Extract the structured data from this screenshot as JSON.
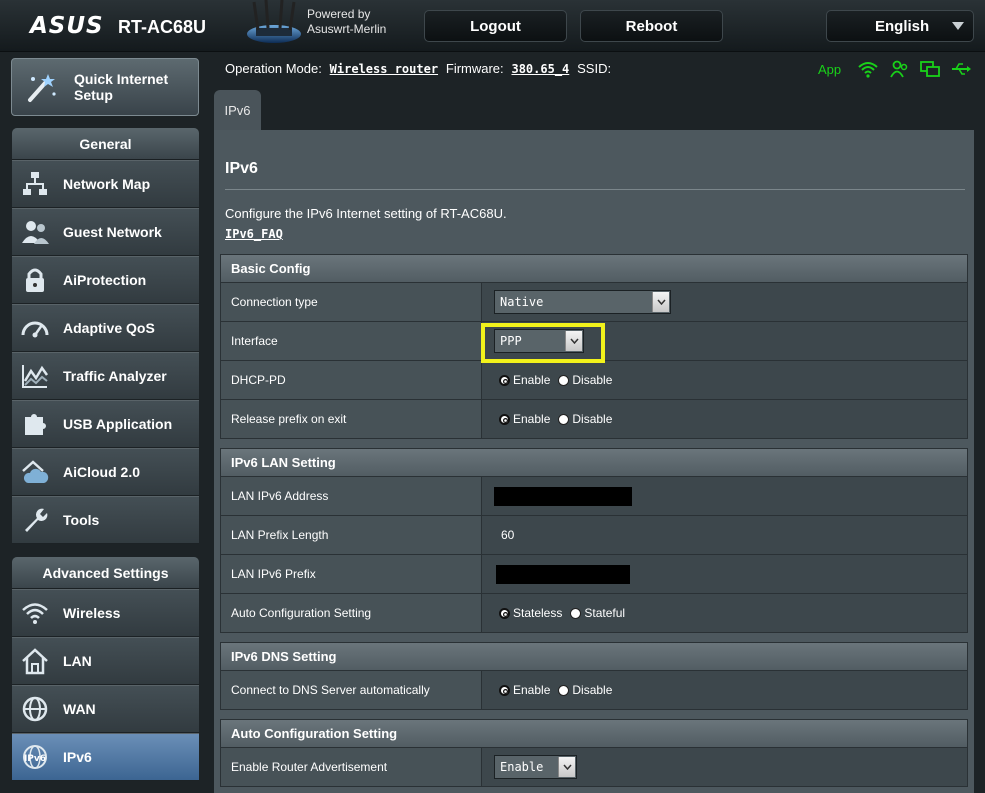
{
  "header": {
    "brand": "ASUS",
    "model": "RT-AC68U",
    "powered_by_line1": "Powered by",
    "powered_by_line2": "Asuswrt-Merlin",
    "logout_label": "Logout",
    "reboot_label": "Reboot",
    "language": "English"
  },
  "sidebar": {
    "quick_setup_label": "Quick Internet Setup",
    "general_header": "General",
    "general_items": [
      {
        "label": "Network Map",
        "icon": "network-map-icon"
      },
      {
        "label": "Guest Network",
        "icon": "guest-network-icon"
      },
      {
        "label": "AiProtection",
        "icon": "lock-icon"
      },
      {
        "label": "Adaptive QoS",
        "icon": "gauge-icon"
      },
      {
        "label": "Traffic Analyzer",
        "icon": "traffic-analyzer-icon"
      },
      {
        "label": "USB Application",
        "icon": "puzzle-icon"
      },
      {
        "label": "AiCloud 2.0",
        "icon": "cloud-home-icon"
      },
      {
        "label": "Tools",
        "icon": "wrench-icon"
      }
    ],
    "advanced_header": "Advanced Settings",
    "advanced_items": [
      {
        "label": "Wireless",
        "icon": "wifi-icon"
      },
      {
        "label": "LAN",
        "icon": "house-icon"
      },
      {
        "label": "WAN",
        "icon": "globe-icon"
      },
      {
        "label": "IPv6",
        "icon": "ipv6-globe-icon",
        "active": true
      }
    ]
  },
  "status": {
    "operation_mode_label": "Operation Mode:",
    "operation_mode_value": "Wireless router",
    "firmware_label": "Firmware:",
    "firmware_value": "380.65_4",
    "ssid_label": "SSID:",
    "app_label": "App",
    "accent_color": "#19d219"
  },
  "tabs": [
    {
      "label": "IPv6",
      "active": true
    }
  ],
  "page": {
    "title": "IPv6",
    "description": "Configure the IPv6 Internet setting of RT-AC68U.",
    "faq_link": "IPv6_FAQ"
  },
  "sections": {
    "basic": {
      "header": "Basic Config",
      "connection_type_label": "Connection type",
      "connection_type_value": "Native",
      "interface_label": "Interface",
      "interface_value": "PPP",
      "dhcp_pd_label": "DHCP-PD",
      "release_prefix_label": "Release prefix on exit",
      "enable": "Enable",
      "disable": "Disable"
    },
    "lan": {
      "header": "IPv6 LAN Setting",
      "address_label": "LAN IPv6 Address",
      "prefix_length_label": "LAN Prefix Length",
      "prefix_length_value": "60",
      "prefix_label": "LAN IPv6 Prefix",
      "autoconf_label": "Auto Configuration Setting",
      "stateless": "Stateless",
      "stateful": "Stateful"
    },
    "dns": {
      "header": "IPv6 DNS Setting",
      "auto_label": "Connect to DNS Server automatically",
      "enable": "Enable",
      "disable": "Disable"
    },
    "autoconf": {
      "header": "Auto Configuration Setting",
      "router_adv_label": "Enable Router Advertisement",
      "router_adv_value": "Enable"
    }
  },
  "highlight_color": "#f2f21b"
}
